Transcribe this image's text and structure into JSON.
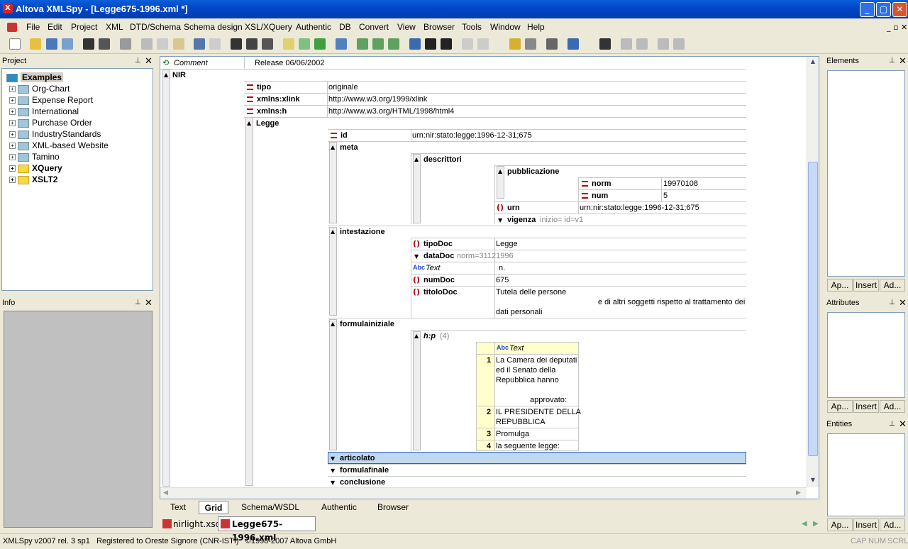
{
  "window": {
    "title": "Altova XMLSpy - [Legge675-1996.xml *]",
    "min": "_",
    "max": "▢",
    "close": "✕"
  },
  "menu": [
    "File",
    "Edit",
    "Project",
    "XML",
    "DTD/Schema",
    "Schema design",
    "XSL/XQuery",
    "Authentic",
    "DB",
    "Convert",
    "View",
    "Browser",
    "Tools",
    "Window",
    "Help"
  ],
  "project": {
    "title": "Project",
    "root": "Examples",
    "items": [
      "Org-Chart",
      "Expense Report",
      "International",
      "Purchase Order",
      "IndustryStandards",
      "XML-based Website",
      "Tamino",
      "XQuery",
      "XSLT2"
    ]
  },
  "info": {
    "title": "Info"
  },
  "grid": {
    "comment_label": "Comment",
    "comment_value": "Release 06/06/2002",
    "nir": "NIR",
    "tipo": "tipo",
    "tipo_val": "originale",
    "xlink": "xmlns:xlink",
    "xlink_val": "http://www.w3.org/1999/xlink",
    "xh": "xmlns:h",
    "xh_val": "http://www.w3.org/HTML/1998/html4",
    "legge": "Legge",
    "id": "id",
    "id_val": "urn:nir:stato:legge:1996-12-31;675",
    "meta": "meta",
    "descrittori": "descrittori",
    "pubblicazione": "pubblicazione",
    "norm": "norm",
    "norm_val": "19970108",
    "num": "num",
    "num_val": "5",
    "urn": "urn",
    "urn_val": "urn:nir:stato:legge:1996-12-31;675",
    "vigenza": "vigenza",
    "vigenza_attr": "inizio= id=v1",
    "intestazione": "intestazione",
    "tipoDoc": "tipoDoc",
    "tipoDoc_val": "Legge",
    "dataDoc": "dataDoc",
    "dataDoc_attr": "norm=31121996",
    "text_label": "Text",
    "text_val": "n.",
    "numDoc": "numDoc",
    "numDoc_val": "675",
    "titoloDoc": "titoloDoc",
    "titolo_l1": "Tutela delle persone",
    "titolo_l2": "e di altri soggetti rispetto al trattamento dei",
    "titolo_l3": "dati personali",
    "formulainiziale": "formulainiziale",
    "hp": "h:p",
    "hp_count": "(4)",
    "tbl_text": "Text",
    "rows": [
      {
        "n": "1",
        "l1": "La Camera dei deputati",
        "l2": "ed il Senato della",
        "l3": "Repubblica hanno",
        "l4": "approvato:"
      },
      {
        "n": "2",
        "l1": "IL PRESIDENTE DELLA",
        "l2": "REPUBBLICA"
      },
      {
        "n": "3",
        "l1": "Promulga"
      },
      {
        "n": "4",
        "l1": "la seguente legge:"
      }
    ],
    "articolato": "articolato",
    "formulafinale": "formulafinale",
    "conclusione": "conclusione"
  },
  "view_tabs": [
    "Text",
    "Grid",
    "Schema/WSDL",
    "Authentic",
    "Browser"
  ],
  "doc_tabs": [
    "nirlight.xsd",
    "Legge675-1996.xml"
  ],
  "right": {
    "elements": "Elements",
    "attributes": "Attributes",
    "entities": "Entities",
    "btn1": "Ap...",
    "btn2": "Insert",
    "btn3": "Ad..."
  },
  "status": {
    "left": "XMLSpy v2007 rel. 3 sp1   Registered to Oreste Signore (CNR-ISTI)   ©1998-2007 Altova GmbH",
    "cap": "CAP",
    "num": "NUM",
    "scrl": "SCRL"
  }
}
